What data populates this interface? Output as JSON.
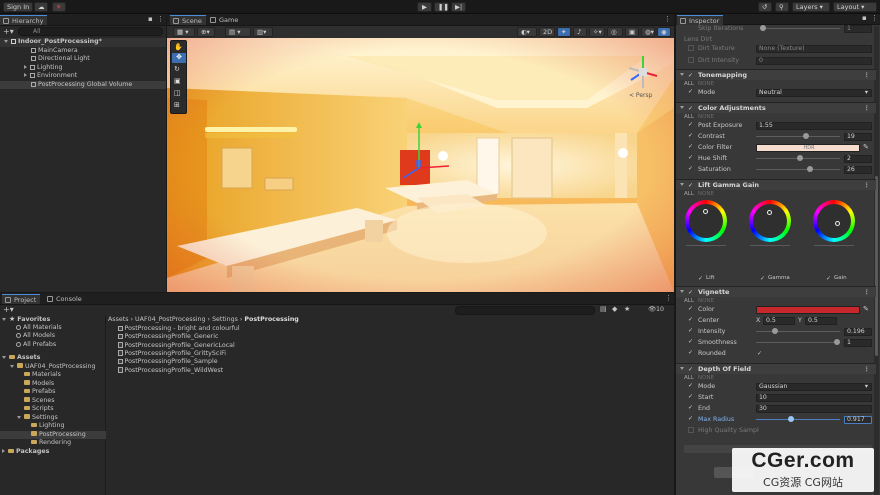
{
  "toolbar": {
    "sign_in": "Sign In",
    "layers": "Layers",
    "layout": "Layout"
  },
  "hierarchy": {
    "tab": "Hierarchy",
    "search_placeholder": "All",
    "items": [
      {
        "label": "Indoor_PostProcessing*",
        "depth": 0
      },
      {
        "label": "MainCamera",
        "depth": 1
      },
      {
        "label": "Directional Light",
        "depth": 1
      },
      {
        "label": "Lighting",
        "depth": 1
      },
      {
        "label": "Environment",
        "depth": 1
      },
      {
        "label": "PostProcessing Global Volume",
        "depth": 1
      }
    ]
  },
  "scene": {
    "tab_scene": "Scene",
    "tab_game": "Game",
    "mode_2d": "2D",
    "persp": "< Persp"
  },
  "project": {
    "tab_project": "Project",
    "tab_console": "Console",
    "count": "10",
    "breadcrumb": [
      "Assets",
      "UAF04_PostProcessing",
      "Settings",
      "PostProcessing"
    ],
    "favorites_label": "Favorites",
    "favorites": [
      "All Materials",
      "All Models",
      "All Prefabs"
    ],
    "assets_label": "Assets",
    "tree": [
      {
        "label": "UAF04_PostProcessing",
        "depth": 1
      },
      {
        "label": "Materials",
        "depth": 2
      },
      {
        "label": "Models",
        "depth": 2
      },
      {
        "label": "Prefabs",
        "depth": 2
      },
      {
        "label": "Scenes",
        "depth": 2
      },
      {
        "label": "Scripts",
        "depth": 2
      },
      {
        "label": "Settings",
        "depth": 2
      },
      {
        "label": "Lighting",
        "depth": 3
      },
      {
        "label": "PostProcessing",
        "depth": 3
      },
      {
        "label": "Rendering",
        "depth": 3
      }
    ],
    "packages_label": "Packages",
    "files": [
      "PostProcessing - bright and colourful",
      "PostProcessingProfile_Generic",
      "PostProcessingProfile_GenericLocal",
      "PostProcessingProfile_GrittySciFi",
      "PostProcessingProfile_Sample",
      "PostProcessingProfile_WildWest"
    ]
  },
  "inspector": {
    "tab": "Inspector",
    "skip_iterations": "Skip Iterations",
    "skip_iterations_value": "1",
    "lens_dirt": "Lens Dirt",
    "dirt_texture": "Dirt Texture",
    "dirt_texture_value": "None (Texture)",
    "dirt_intensity": "Dirt Intensity",
    "dirt_intensity_value": "0",
    "all": "ALL",
    "none": "NONE",
    "tonemapping": {
      "title": "Tonemapping",
      "mode_label": "Mode",
      "mode_value": "Neutral"
    },
    "color_adjustments": {
      "title": "Color Adjustments",
      "post_exposure": "Post Exposure",
      "post_exposure_value": "1.55",
      "contrast": "Contrast",
      "contrast_value": "19",
      "color_filter": "Color Filter",
      "color_filter_value": "HDR",
      "hue_shift": "Hue Shift",
      "hue_shift_value": "2",
      "saturation": "Saturation",
      "saturation_value": "26"
    },
    "lgg": {
      "title": "Lift Gamma Gain",
      "lift": "Lift",
      "gamma": "Gamma",
      "gain": "Gain"
    },
    "vignette": {
      "title": "Vignette",
      "color": "Color",
      "color_value": "#c8282c",
      "center": "Center",
      "x_label": "X",
      "x_value": "0.5",
      "y_label": "Y",
      "y_value": "0.5",
      "intensity": "Intensity",
      "intensity_value": "0.196",
      "smoothness": "Smoothness",
      "smoothness_value": "1",
      "rounded": "Rounded"
    },
    "dof": {
      "title": "Depth Of Field",
      "mode": "Mode",
      "mode_value": "Gaussian",
      "start": "Start",
      "start_value": "10",
      "end": "End",
      "end_value": "30",
      "max_radius": "Max Radius",
      "max_radius_value": "0.917",
      "high_quality": "High Quality Sampl"
    }
  },
  "watermark": {
    "title": "CGer.com",
    "subtitle": "CG资源 CG网站"
  }
}
